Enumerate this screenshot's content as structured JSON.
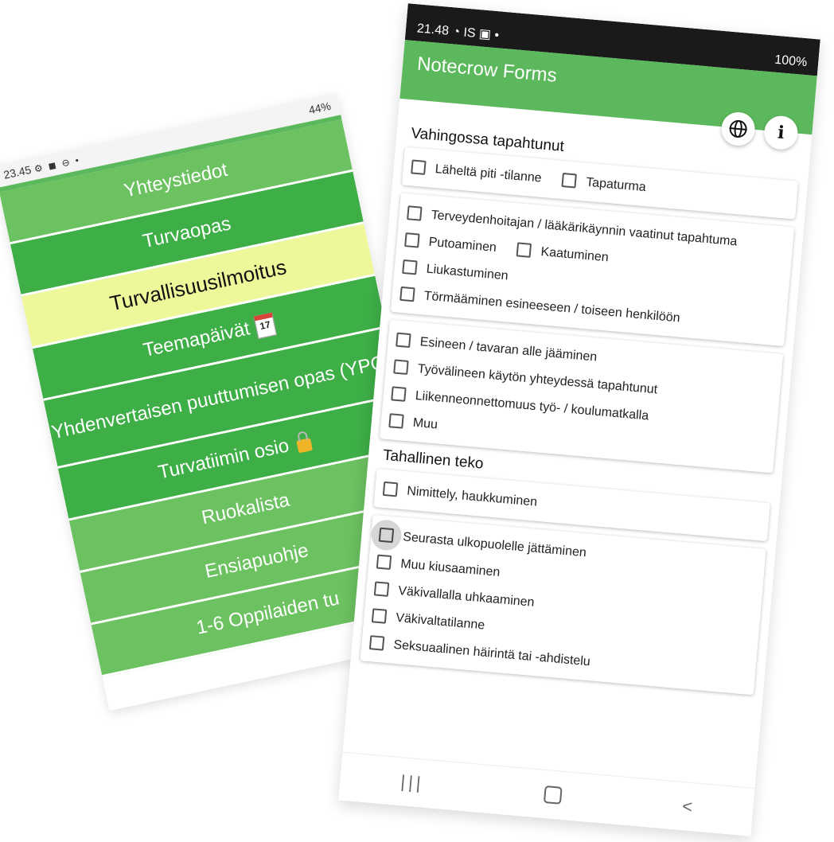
{
  "left_phone": {
    "status_time": "23.45",
    "status_icons": "⚙ ◼ ⊖ •",
    "status_right": "44%",
    "menu": [
      {
        "label": "Yhteystiedot"
      },
      {
        "label": "Turvaopas"
      },
      {
        "label": "Turvallisuusilmoitus"
      },
      {
        "label": "Teemapäivät",
        "badge": "17"
      },
      {
        "label": "Yhdenvertaisen puuttumisen opas (YPO)"
      },
      {
        "label": "Turvatiimin osio"
      },
      {
        "label": "Ruokalista"
      },
      {
        "label": "Ensiapuohje"
      },
      {
        "label": "1-6 Oppilaiden tu"
      }
    ]
  },
  "right_phone": {
    "status_time": "21.48",
    "status_icons": "◔ IS ▣ •",
    "status_battery": "100%",
    "app_title": "Notecrow Forms",
    "info_label": "i",
    "section1": {
      "title": "Vahingossa tapahtunut",
      "card1": [
        "Läheltä piti -tilanne",
        "Tapaturma"
      ],
      "card2": [
        "Terveydenhoitajan / lääkärikäynnin vaatinut tapahtuma",
        "Putoaminen",
        "Kaatuminen",
        "Liukastuminen",
        "Törmääminen esineeseen / toiseen henkilöön"
      ],
      "card3": [
        "Esineen / tavaran alle jääminen",
        "Työvälineen käytön yhteydessä tapahtunut",
        "Liikenneonnettomuus työ- / koulumatkalla",
        "Muu"
      ]
    },
    "section2": {
      "title": "Tahallinen teko",
      "card1": [
        "Nimittely, haukkuminen"
      ],
      "card2": [
        "Seurasta ulkopuolelle jättäminen",
        "Muu kiusaaminen",
        "Väkivallalla uhkaaminen",
        "Väkivaltatilanne",
        "Seksuaalinen häirintä tai -ahdistelu"
      ]
    },
    "nav": {
      "recents": "|||",
      "back": "<"
    }
  }
}
